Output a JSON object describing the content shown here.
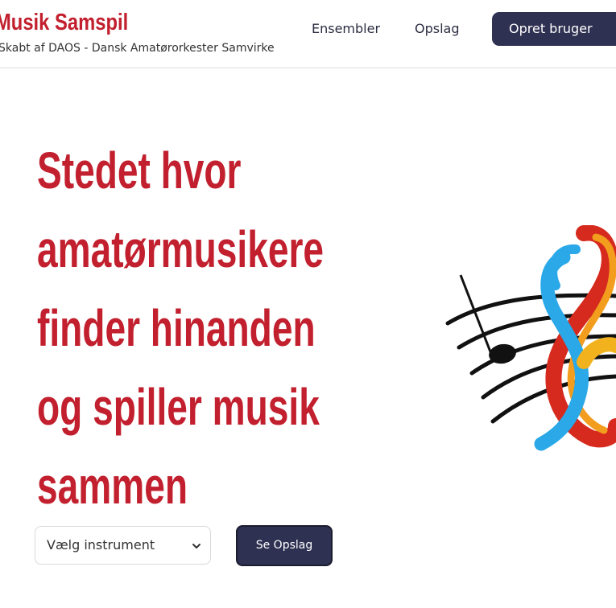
{
  "header": {
    "brand_title": "Musik Samspil",
    "brand_subtitle": "Skabt af DAOS - Dansk Amatørorkester Samvirke",
    "nav": {
      "ensembler": "Ensembler",
      "opslag": "Opslag"
    },
    "signup_label": "Opret bruger"
  },
  "hero": {
    "title_lines": [
      "Stedet hvor",
      "amatørmusikere",
      "finder hinanden",
      "og spiller musik",
      "sammen"
    ],
    "select_placeholder": "Vælg instrument",
    "see_button": "Se Opslag"
  },
  "colors": {
    "brand_red": "#c2202e",
    "button_navy": "#2f3152"
  },
  "icons": {
    "select_chevron": "chevron-down-icon",
    "illustration": "music-staff-treble-clef-illustration"
  }
}
